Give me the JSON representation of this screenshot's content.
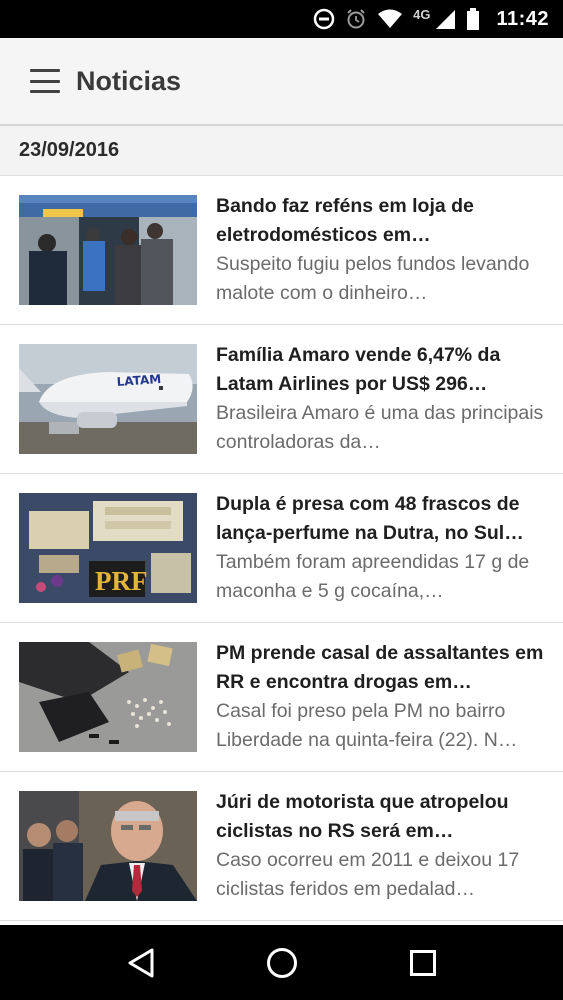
{
  "status_bar": {
    "network": "4G",
    "time": "11:42"
  },
  "app_bar": {
    "title": "Noticias"
  },
  "date_header": "23/09/2016",
  "news": [
    {
      "headline": "Bando faz reféns em loja de eletrodomésticos em…",
      "summary": "Suspeito fugiu pelos fundos levando malote com o dinheiro…",
      "thumb_icon": "photo-store-hostage"
    },
    {
      "headline": "Família Amaro vende 6,47% da Latam Airlines por US$ 296…",
      "summary": "Brasileira Amaro é uma das principais controladoras da…",
      "thumb_icon": "photo-latam-airplane",
      "thumb_text": "LATAM"
    },
    {
      "headline": "Dupla é presa com 48 frascos de lança-perfume na Dutra, no Sul…",
      "summary": "Também foram apreendidas 17 g de maconha e 5 g cocaína,…",
      "thumb_icon": "photo-prf-seizure",
      "thumb_text": "PRF"
    },
    {
      "headline": "PM prende casal de assaltantes em RR e encontra drogas em…",
      "summary": "Casal foi preso pela PM no bairro Liberdade na quinta-feira (22). N…",
      "thumb_icon": "photo-drugs-seized"
    },
    {
      "headline": "Júri de motorista que atropelou ciclistas no RS será em…",
      "summary": "Caso ocorreu em 2011 e deixou 17 ciclistas feridos em pedalad…",
      "thumb_icon": "photo-man-in-suit"
    }
  ],
  "nav_bar": {
    "back_icon": "back-triangle-icon",
    "home_icon": "home-circle-icon",
    "recents_icon": "recents-square-icon"
  }
}
